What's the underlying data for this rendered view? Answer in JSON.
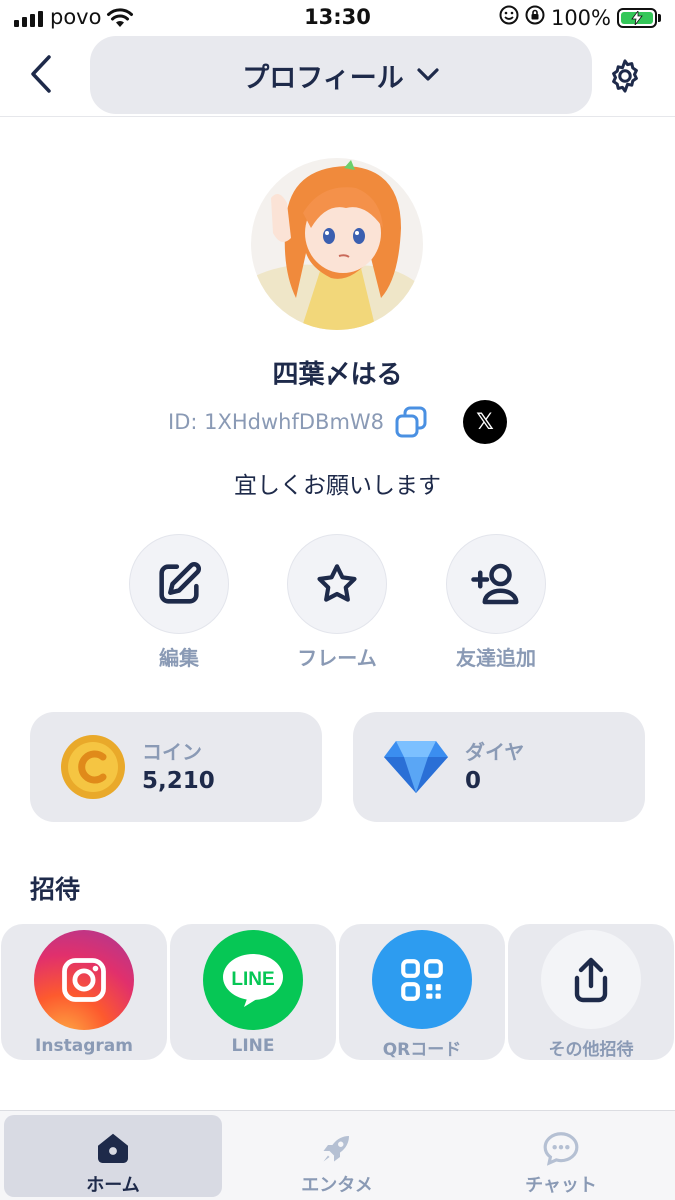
{
  "status_bar": {
    "carrier": "povo",
    "time": "13:30",
    "battery": "100%"
  },
  "header": {
    "title": "プロフィール"
  },
  "profile": {
    "username": "四葉〆はる",
    "id": "ID: 1XHdwhfDBmW8",
    "bio": "宜しくお願いします",
    "x_glyph": "𝕏"
  },
  "actions": [
    {
      "label": "編集",
      "icon": "edit-icon"
    },
    {
      "label": "フレーム",
      "icon": "star-icon"
    },
    {
      "label": "友達追加",
      "icon": "add-friend-icon"
    }
  ],
  "wallet": {
    "coin": {
      "label": "コイン",
      "value": "5,210"
    },
    "diamond": {
      "label": "ダイヤ",
      "value": "0"
    }
  },
  "invite": {
    "title": "招待",
    "items": [
      {
        "label": "Instagram",
        "icon": "instagram-icon",
        "color": "#e1306c"
      },
      {
        "label": "LINE",
        "icon": "line-icon",
        "color": "#06c755",
        "logo_text": "LINE"
      },
      {
        "label": "QRコード",
        "icon": "qr-code-icon",
        "color": "#2d9cf0"
      },
      {
        "label": "その他招待",
        "icon": "share-icon",
        "color": "#f3f4f7"
      }
    ]
  },
  "tabs": [
    {
      "label": "ホーム",
      "icon": "home-icon",
      "active": true
    },
    {
      "label": "エンタメ",
      "icon": "rocket-icon",
      "active": false
    },
    {
      "label": "チャット",
      "icon": "chat-icon",
      "active": false
    }
  ],
  "colors": {
    "primary": "#1e2a4a",
    "muted": "#8a9ab5",
    "surface": "#e8e9ee",
    "battery_green": "#34c759"
  }
}
